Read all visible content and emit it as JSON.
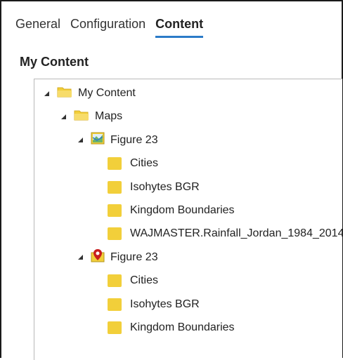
{
  "tabs": [
    {
      "label": "General"
    },
    {
      "label": "Configuration"
    },
    {
      "label": "Content",
      "active": true
    }
  ],
  "section_title": "My Content",
  "tree": [
    {
      "label": "My Content",
      "type": "folder",
      "level": 0,
      "expanded": true
    },
    {
      "label": "Maps",
      "type": "folder",
      "level": 1,
      "expanded": true
    },
    {
      "label": "Figure 23",
      "type": "map",
      "level": 2,
      "expanded": true
    },
    {
      "label": "Cities",
      "type": "layer",
      "level": 3
    },
    {
      "label": "Isohytes BGR",
      "type": "layer",
      "level": 3
    },
    {
      "label": "Kingdom Boundaries",
      "type": "layer",
      "level": 3
    },
    {
      "label": "WAJMASTER.Rainfall_Jordan_1984_2014",
      "type": "layer",
      "level": 3
    },
    {
      "label": "Figure 23",
      "type": "map-marker",
      "level": 2,
      "expanded": true
    },
    {
      "label": "Cities",
      "type": "layer",
      "level": 3
    },
    {
      "label": "Isohytes BGR",
      "type": "layer",
      "level": 3
    },
    {
      "label": "Kingdom Boundaries",
      "type": "layer",
      "level": 3
    }
  ],
  "colors": {
    "accent": "#2b7bc8",
    "folder": "#f2cf3a",
    "layer": "#f2cf3a",
    "marker": "#c81e1e"
  },
  "icons": {
    "expanded": "triangle-down-icon",
    "folder": "folder-icon",
    "map": "map-icon",
    "map-marker": "map-pin-icon",
    "layer": "layer-icon"
  }
}
